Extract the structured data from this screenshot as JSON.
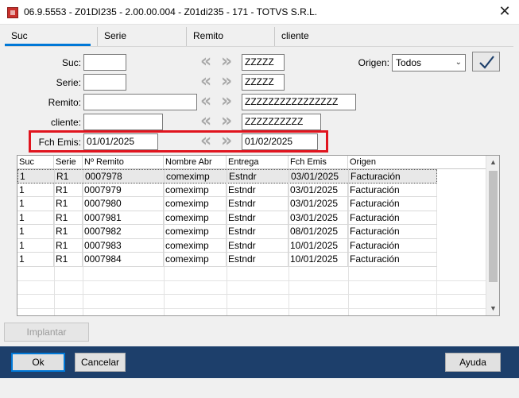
{
  "window": {
    "title": "06.9.5553 - Z01DI235 - 2.00.00.004 - Z01di235 - 171 - TOTVS S.R.L."
  },
  "tabs": [
    {
      "label": "Suc"
    },
    {
      "label": "Serie"
    },
    {
      "label": "Remito"
    },
    {
      "label": "cliente"
    }
  ],
  "filters": {
    "suc": {
      "label": "Suc:",
      "from": "",
      "to": "ZZZZZ"
    },
    "serie": {
      "label": "Serie:",
      "from": "",
      "to": "ZZZZZ"
    },
    "remito": {
      "label": "Remito:",
      "from": "",
      "to": "ZZZZZZZZZZZZZZZZ"
    },
    "cliente": {
      "label": "cliente:",
      "from": "",
      "to": "ZZZZZZZZZZ"
    },
    "fch_emis": {
      "label": "Fch Emis:",
      "from": "01/01/2025",
      "to": "01/02/2025"
    }
  },
  "origen": {
    "label": "Origen:",
    "value": "Todos"
  },
  "grid": {
    "columns": [
      "Suc",
      "Serie",
      "Nº Remito",
      "Nombre Abr",
      "Entrega",
      "Fch Emis",
      "Origen"
    ],
    "rows": [
      [
        "1",
        "R1",
        "0007978",
        "comeximp",
        "Estndr",
        "03/01/2025",
        "Facturación"
      ],
      [
        "1",
        "R1",
        "0007979",
        "comeximp",
        "Estndr",
        "03/01/2025",
        "Facturación"
      ],
      [
        "1",
        "R1",
        "0007980",
        "comeximp",
        "Estndr",
        "03/01/2025",
        "Facturación"
      ],
      [
        "1",
        "R1",
        "0007981",
        "comeximp",
        "Estndr",
        "03/01/2025",
        "Facturación"
      ],
      [
        "1",
        "R1",
        "0007982",
        "comeximp",
        "Estndr",
        "08/01/2025",
        "Facturación"
      ],
      [
        "1",
        "R1",
        "0007983",
        "comeximp",
        "Estndr",
        "10/01/2025",
        "Facturación"
      ],
      [
        "1",
        "R1",
        "0007984",
        "comeximp",
        "Estndr",
        "10/01/2025",
        "Facturación"
      ]
    ]
  },
  "buttons": {
    "implantar": "Implantar",
    "ok": "Ok",
    "cancelar": "Cancelar",
    "ayuda": "Ayuda"
  },
  "colors": {
    "footer": "#1d3f6b",
    "highlight": "#e0141e",
    "accent": "#0078d7"
  }
}
